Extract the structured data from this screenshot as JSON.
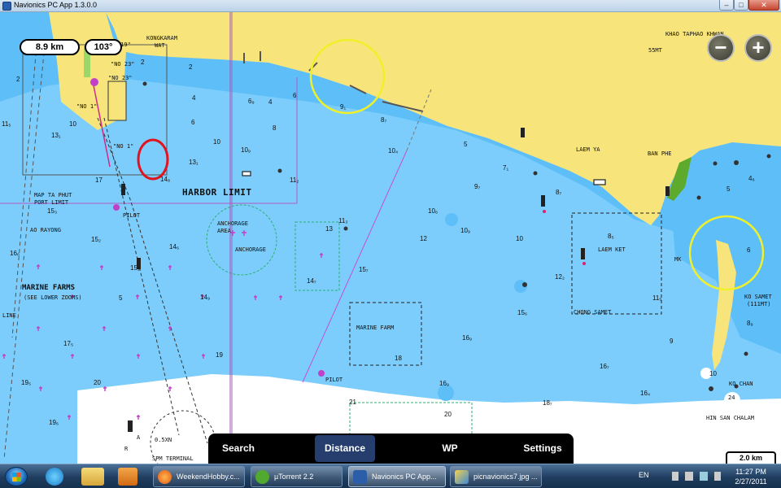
{
  "window": {
    "title": "Navionics PC App 1.3.0.0",
    "min": "–",
    "max": "□",
    "close": "✕"
  },
  "measure": {
    "distance": "8.9 km",
    "bearing": "103°"
  },
  "zoom": {
    "out": "−",
    "in": "+"
  },
  "scale": "2.0 km",
  "labels": {
    "kongkaram": "KONGKARAM",
    "wat": "WAT",
    "khao_taphao": "KHAO TAPHAO KHWAN",
    "h55mt": "55MT",
    "laem_ya": "LAEM YA",
    "ban_phe": "BAN PHE",
    "harbor_limit": "HARBOR LIMIT",
    "map_ta_phut_1": "MAP TA PHUT",
    "map_ta_phut_2": "PORT LIMIT",
    "ao_rayong": "AO RAYONG",
    "pilot_1": "PILOT",
    "pilot_2": "PILOT",
    "anchorage_1": "ANCHORAGE",
    "anchorage_2": "AREA",
    "anchorage_3": "ANCHORAGE",
    "marine_farms": "MARINE FARMS",
    "see_lower": "(SEE LOWER ZOOMS)",
    "marine_farm": "MARINE FARM",
    "laem_ket": "LAEM KET",
    "chong_samet": "CHONG SAMET",
    "ko_samet_1": "KO SAMET",
    "ko_samet_2": "(111MT)",
    "ko_chan": "KO CHAN",
    "hin_san_chalam": "HIN SAN CHALAM",
    "line": "LINE",
    "terminal": "SPM TERMINAL",
    "n0_5": "0.5XN",
    "mk": "MK",
    "no23a": "\"NO 23\"",
    "no23b": "\"NO 23\"",
    "no19": "\"19\"",
    "no1a": "\"NO 1\"",
    "no1b": "\"NO 1\"",
    "r": "R",
    "a": "A",
    "n24": "24"
  },
  "depths": [
    {
      "t": "2",
      "c": "d1"
    },
    {
      "t": "2",
      "c": "d2"
    },
    {
      "t": "6",
      "c": "d3"
    },
    {
      "t": "4",
      "c": "d4"
    },
    {
      "t": "2",
      "c": "d5"
    },
    {
      "t": "4",
      "c": "d6"
    },
    {
      "t": "11₅",
      "c": "d7"
    },
    {
      "t": "10",
      "c": "d8"
    },
    {
      "t": "13₁",
      "c": "d9"
    },
    {
      "t": "10",
      "c": "d10"
    },
    {
      "t": "6₉",
      "c": "d11"
    },
    {
      "t": "8₇",
      "c": "d12"
    },
    {
      "t": "5",
      "c": "d13"
    },
    {
      "t": "6",
      "c": "d14"
    },
    {
      "t": "8",
      "c": "d15"
    },
    {
      "t": "10₉",
      "c": "d16"
    },
    {
      "t": "13₁",
      "c": "d17"
    },
    {
      "t": "11₂",
      "c": "d18"
    },
    {
      "t": "10₄",
      "c": "d19"
    },
    {
      "t": "8₇",
      "c": "d20"
    },
    {
      "t": "7₁",
      "c": "d21"
    },
    {
      "t": "9₇",
      "c": "d22"
    },
    {
      "t": "10₆",
      "c": "d23"
    },
    {
      "t": "11₃",
      "c": "d24"
    },
    {
      "t": "12",
      "c": "d25"
    },
    {
      "t": "10₉",
      "c": "d26"
    },
    {
      "t": "10",
      "c": "d27"
    },
    {
      "t": "15₃",
      "c": "d28"
    },
    {
      "t": "15₂",
      "c": "d29"
    },
    {
      "t": "14₆",
      "c": "d30"
    },
    {
      "t": "15₁",
      "c": "d31"
    },
    {
      "t": "16₆",
      "c": "d32"
    },
    {
      "t": "15₇",
      "c": "d33"
    },
    {
      "t": "14₇",
      "c": "d34"
    },
    {
      "t": "12₂",
      "c": "d35"
    },
    {
      "t": "8₅",
      "c": "d36"
    },
    {
      "t": "15₆",
      "c": "d37"
    },
    {
      "t": "14₉",
      "c": "d38"
    },
    {
      "t": "19",
      "c": "d39"
    },
    {
      "t": "16₉",
      "c": "d40"
    },
    {
      "t": "17₅",
      "c": "d41"
    },
    {
      "t": "16₇",
      "c": "d42"
    },
    {
      "t": "16₄",
      "c": "d43"
    },
    {
      "t": "18",
      "c": "d44"
    },
    {
      "t": "19₅",
      "c": "d45"
    },
    {
      "t": "20",
      "c": "d46"
    },
    {
      "t": "16₉",
      "c": "d47"
    },
    {
      "t": "18₇",
      "c": "d48"
    },
    {
      "t": "19₆",
      "c": "d49"
    },
    {
      "t": "20",
      "c": "d50"
    },
    {
      "t": "21",
      "c": "d51"
    },
    {
      "t": "11₅",
      "c": "d52"
    },
    {
      "t": "10",
      "c": "d53"
    },
    {
      "t": "9₁",
      "c": "d54"
    },
    {
      "t": "8₉",
      "c": "d55"
    },
    {
      "t": "4₆",
      "c": "d56"
    },
    {
      "t": "5",
      "c": "d57"
    },
    {
      "t": "6",
      "c": "d58"
    },
    {
      "t": "13",
      "c": "d59"
    },
    {
      "t": "17",
      "c": "d60"
    },
    {
      "t": "14₈",
      "c": "d61"
    },
    {
      "t": "5",
      "c": "d62"
    },
    {
      "t": "9",
      "c": "d63"
    }
  ],
  "toolbar": {
    "search": "Search",
    "distance": "Distance",
    "wp": "WP",
    "settings": "Settings"
  },
  "taskbar": {
    "tasks": [
      "WeekendHobby.c...",
      "µTorrent 2.2",
      "Navionics PC App...",
      "picnavionics7.jpg ..."
    ],
    "lang": "EN",
    "time": "11:27 PM",
    "date": "2/27/2011"
  },
  "colors": {
    "land": "#f7e57b",
    "shallow": "#5ebef8",
    "deep": "#7ccdfb",
    "dry": "#ffffff",
    "annotation_red": "#e0141e",
    "annotation_yellow": "#f0f02a"
  }
}
